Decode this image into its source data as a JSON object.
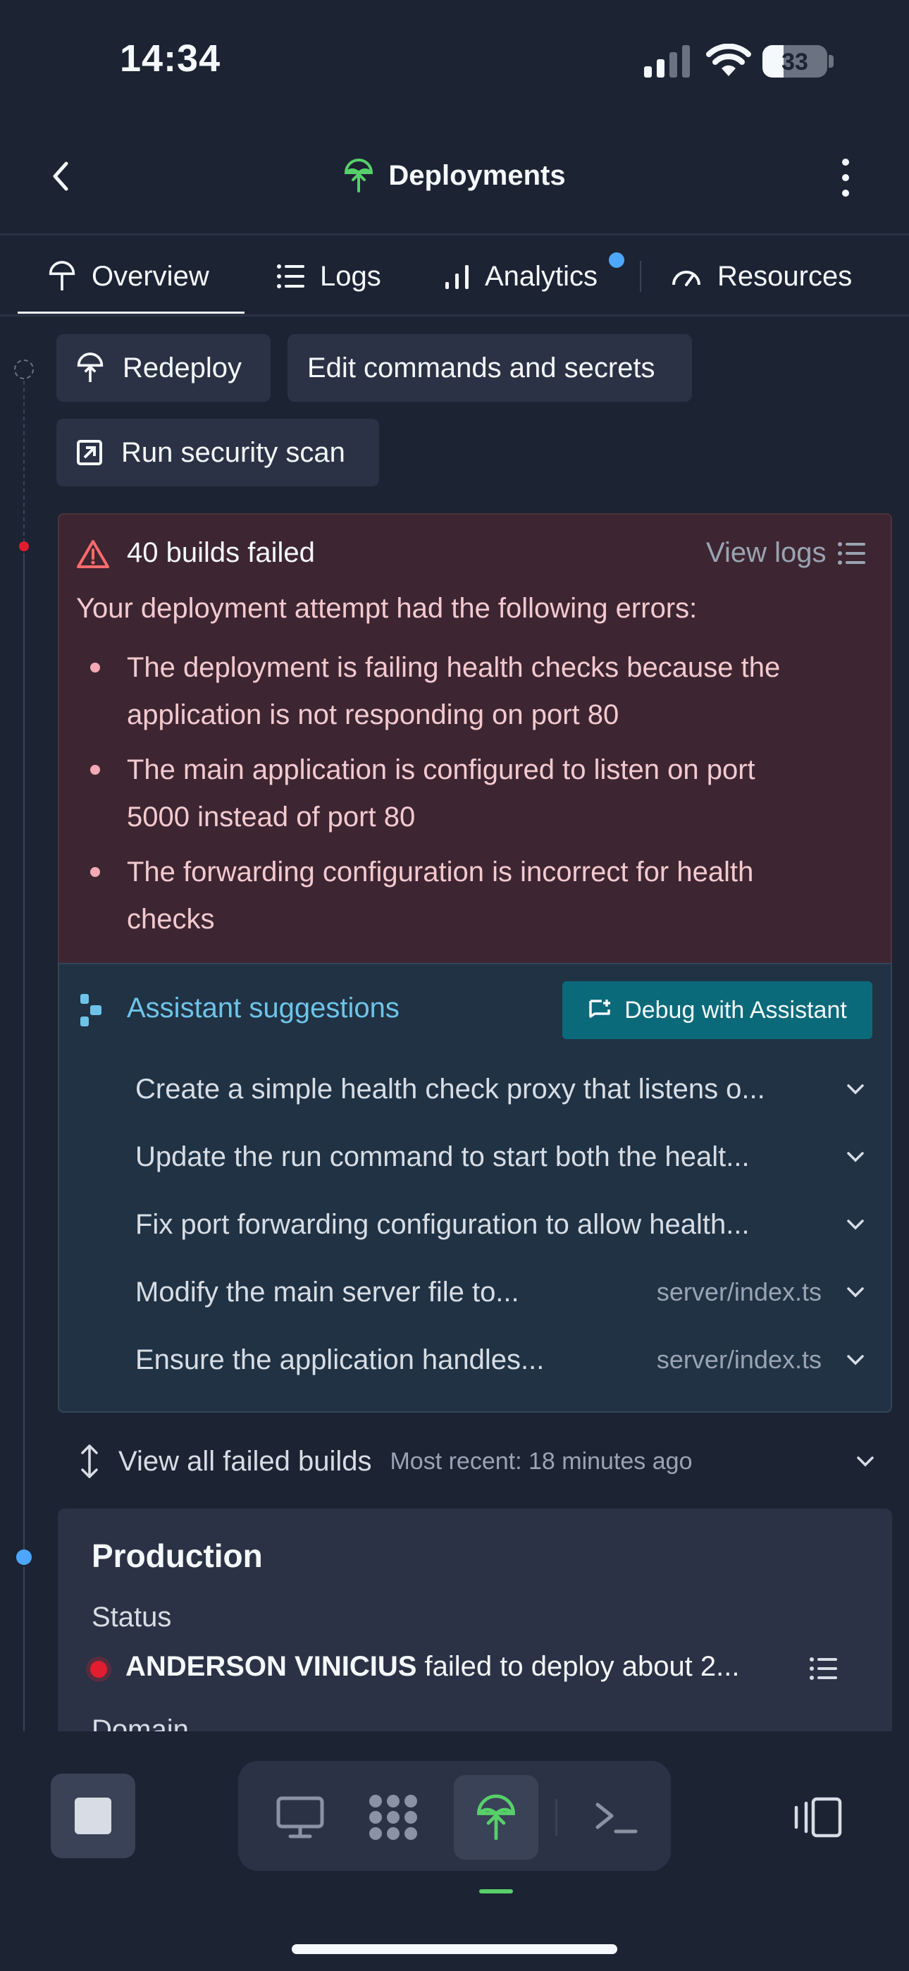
{
  "status_bar": {
    "time": "14:34",
    "battery": "33",
    "battery_level": 0.33
  },
  "nav": {
    "title": "Deployments"
  },
  "tabs": [
    {
      "label": "Overview",
      "icon": "deploy-icon",
      "active": true
    },
    {
      "label": "Logs",
      "icon": "list-icon"
    },
    {
      "label": "Analytics",
      "icon": "bar-chart-icon",
      "badge": true
    },
    {
      "label": "Resources",
      "icon": "gauge-icon"
    }
  ],
  "actions": {
    "redeploy": "Redeploy",
    "edit": "Edit commands and secrets",
    "scan": "Run security scan"
  },
  "error": {
    "title": "40 builds failed",
    "view_logs": "View logs",
    "intro": "Your deployment attempt had the following errors:",
    "items": [
      {
        "line1": "The deployment is failing health checks because the",
        "line2": "application is not responding on port 80"
      },
      {
        "line1": "The main application is configured to listen on port",
        "line2": "5000 instead of port 80"
      },
      {
        "line1": "The forwarding configuration is incorrect for health",
        "line2": "checks"
      }
    ]
  },
  "assistant": {
    "title": "Assistant suggestions",
    "debug_button": "Debug with Assistant",
    "suggestions": [
      {
        "text": "Create a simple health check proxy that listens o...",
        "file": ""
      },
      {
        "text": "Update the run command to start both the healt...",
        "file": ""
      },
      {
        "text": "Fix port forwarding configuration to allow health...",
        "file": ""
      },
      {
        "text": "Modify the main server file to...",
        "file": "server/index.ts"
      },
      {
        "text": "Ensure the application handles...",
        "file": "server/index.ts"
      }
    ]
  },
  "failed_builds": {
    "label": "View all failed builds",
    "recent": "Most recent: 18 minutes ago"
  },
  "production": {
    "title": "Production",
    "status_label": "Status",
    "user": "ANDERSON VINICIUS",
    "status_text": " failed to deploy about 2...",
    "domain_label": "Domain"
  },
  "colors": {
    "background": "#1c2333",
    "error_bg": "#3d2631",
    "assistant_bg": "#203244",
    "accent_green": "#57d06a",
    "accent_blue": "#4da6ff",
    "debug_button": "#0b6a7a",
    "status_red": "#e11d2f",
    "assistant_text": "#6ec4e8"
  }
}
